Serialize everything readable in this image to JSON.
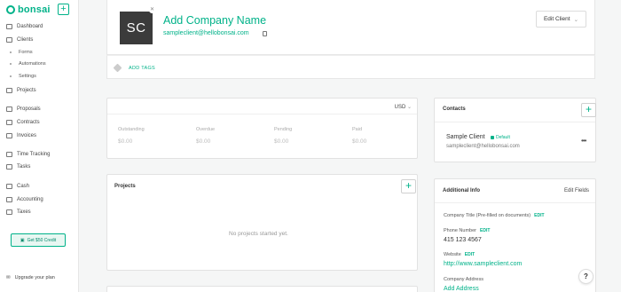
{
  "app": {
    "logo_text": "bonsai",
    "accent": "#00b289"
  },
  "sidebar": {
    "items": [
      {
        "label": "Dashboard",
        "icon": "home-icon"
      },
      {
        "label": "Clients",
        "icon": "clients-icon"
      },
      {
        "label": "Projects",
        "icon": "projects-icon"
      },
      {
        "label": "Proposals",
        "icon": "proposals-icon"
      },
      {
        "label": "Contracts",
        "icon": "contracts-icon"
      },
      {
        "label": "Invoices",
        "icon": "invoices-icon"
      },
      {
        "label": "Time Tracking",
        "icon": "clock-icon"
      },
      {
        "label": "Tasks",
        "icon": "tasks-icon"
      },
      {
        "label": "Cash",
        "icon": "cash-icon"
      },
      {
        "label": "Accounting",
        "icon": "accounting-icon"
      },
      {
        "label": "Taxes",
        "icon": "taxes-icon"
      }
    ],
    "sub_items": [
      "Forms",
      "Automations",
      "Settings"
    ],
    "credit_label": "Get $50 Credit",
    "upgrade_label": "Upgrade your plan"
  },
  "client": {
    "initials": "SC",
    "name": "Add Company Name",
    "email": "sampleclient@hellobonsai.com",
    "edit_label": "Edit Client",
    "add_tags_label": "ADD TAGS"
  },
  "stats": {
    "currency": "USD",
    "items": [
      {
        "label": "Outstanding",
        "value": "$0.00"
      },
      {
        "label": "Overdue",
        "value": "$0.00"
      },
      {
        "label": "Pending",
        "value": "$0.00"
      },
      {
        "label": "Paid",
        "value": "$0.00"
      }
    ]
  },
  "projects": {
    "title": "Projects",
    "empty_text": "No projects started yet."
  },
  "contacts": {
    "title": "Contacts",
    "contact_name": "Sample Client",
    "default_label": "Default",
    "contact_email": "sampleclient@hellobonsai.com"
  },
  "additional_info": {
    "title": "Additional Info",
    "edit_fields_label": "Edit Fields",
    "edit_label": "EDIT",
    "company_title_label": "Company Title (Pre-filled on documents)",
    "phone_label": "Phone Number",
    "phone_value": "415 123 4567",
    "website_label": "Website",
    "website_value": "http://www.sampleclient.com",
    "address_label": "Company Address",
    "address_link": "Add Address"
  },
  "help_label": "?"
}
